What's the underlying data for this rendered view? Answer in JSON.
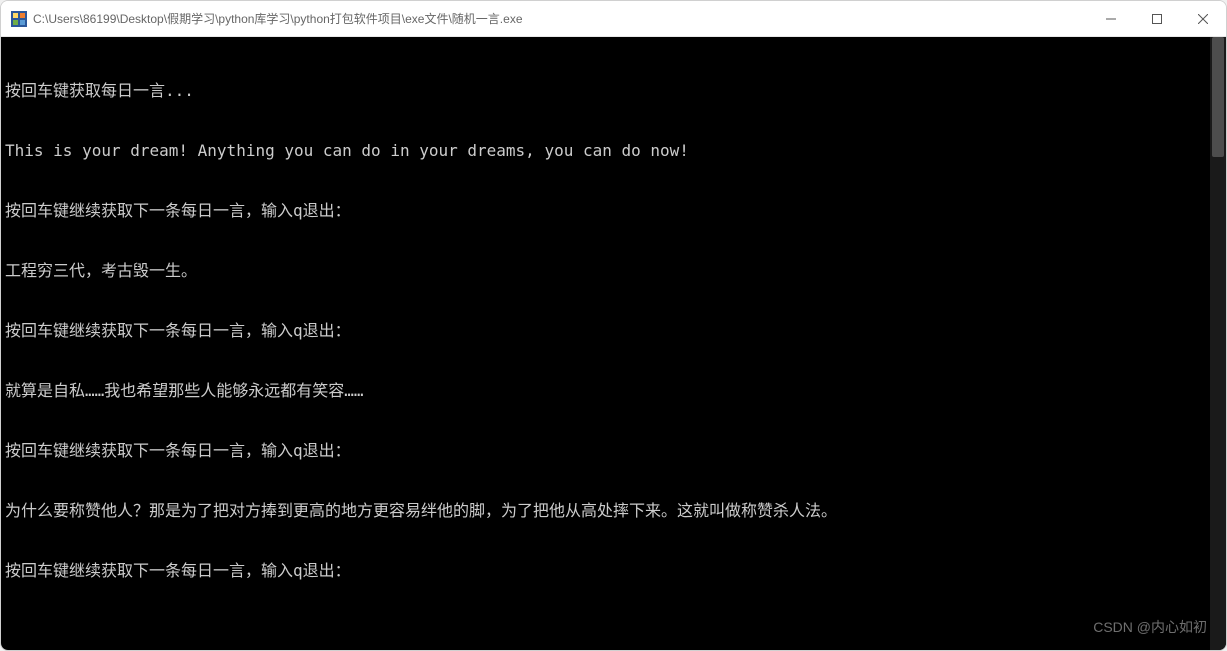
{
  "window": {
    "title": "C:\\Users\\86199\\Desktop\\假期学习\\python库学习\\python打包软件项目\\exe文件\\随机一言.exe"
  },
  "console": {
    "lines": [
      "按回车键获取每日一言...",
      "This is your dream! Anything you can do in your dreams, you can do now!",
      "按回车键继续获取下一条每日一言，输入q退出：",
      "工程穷三代，考古毁一生。",
      "按回车键继续获取下一条每日一言，输入q退出：",
      "就算是自私……我也希望那些人能够永远都有笑容……",
      "按回车键继续获取下一条每日一言，输入q退出：",
      "为什么要称赞他人？那是为了把对方捧到更高的地方更容易绊他的脚，为了把他从高处摔下来。这就叫做称赞杀人法。",
      "按回车键继续获取下一条每日一言，输入q退出："
    ]
  },
  "watermark": "CSDN @内心如初"
}
